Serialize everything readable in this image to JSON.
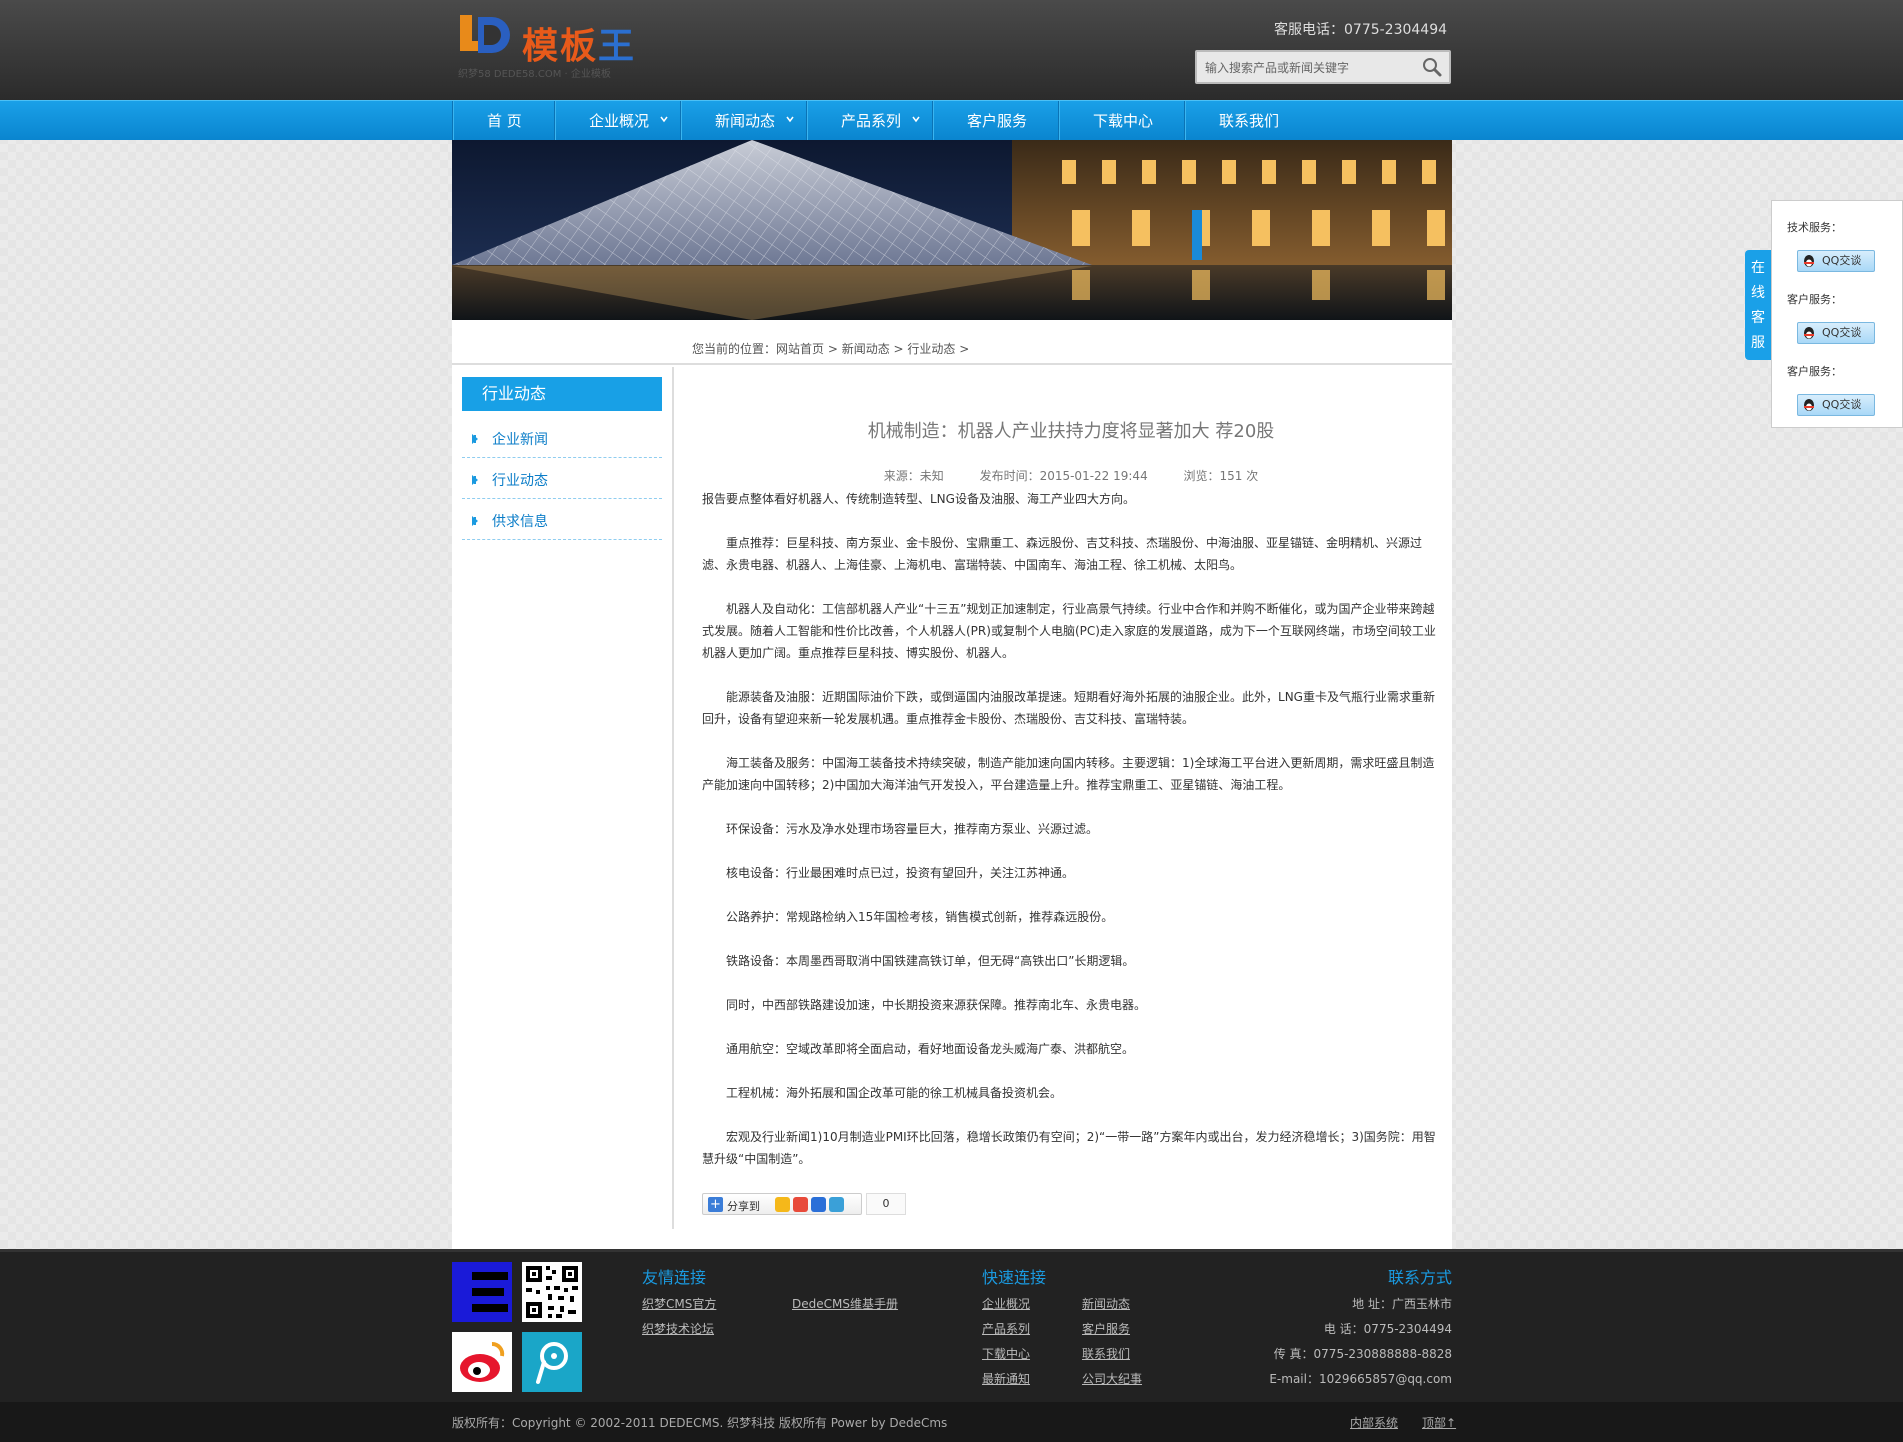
{
  "header": {
    "logo_text_a": "模板",
    "logo_text_b": "王",
    "logo_sub": "织梦58 DEDE58.COM · 企业模板",
    "phone": "客服电话：0775-2304494",
    "search_placeholder": "输入搜索产品或新闻关键字"
  },
  "nav": {
    "items": [
      {
        "label": "首 页"
      },
      {
        "label": "企业概况"
      },
      {
        "label": "新闻动态"
      },
      {
        "label": "产品系列"
      },
      {
        "label": "客户服务"
      },
      {
        "label": "下载中心"
      },
      {
        "label": "联系我们"
      }
    ]
  },
  "breadcrumb": {
    "prefix": "您当前的位置：",
    "home": "网站首页",
    "sep1": " > ",
    "news": "新闻动态",
    "sep2": " > ",
    "current": "行业动态",
    "sep3": " >"
  },
  "sidebar": {
    "title": "行业动态",
    "items": [
      {
        "label": "企业新闻"
      },
      {
        "label": "行业动态"
      },
      {
        "label": "供求信息"
      }
    ]
  },
  "article": {
    "title": "机械制造：机器人产业扶持力度将显著加大 荐20股",
    "source": "来源：未知",
    "time": "发布时间：2015-01-22 19:44",
    "views": "浏览：151 次",
    "paragraphs": [
      "报告要点整体看好机器人、传统制造转型、LNG设备及油服、海工产业四大方向。",
      "重点推荐：巨星科技、南方泵业、金卡股份、宝鼎重工、森远股份、吉艾科技、杰瑞股份、中海油服、亚星锚链、金明精机、兴源过滤、永贵电器、机器人、上海佳豪、上海机电、富瑞特装、中国南车、海油工程、徐工机械、太阳鸟。",
      "机器人及自动化：工信部机器人产业“十三五”规划正加速制定，行业高景气持续。行业中合作和并购不断催化，或为国产企业带来跨越式发展。随着人工智能和性价比改善，个人机器人(PR)或复制个人电脑(PC)走入家庭的发展道路，成为下一个互联网终端，市场空间较工业机器人更加广阔。重点推荐巨星科技、博实股份、机器人。",
      "能源装备及油服：近期国际油价下跌，或倒逼国内油服改革提速。短期看好海外拓展的油服企业。此外，LNG重卡及气瓶行业需求重新回升，设备有望迎来新一轮发展机遇。重点推荐金卡股份、杰瑞股份、吉艾科技、富瑞特装。",
      "海工装备及服务：中国海工装备技术持续突破，制造产能加速向国内转移。主要逻辑：1)全球海工平台进入更新周期，需求旺盛且制造产能加速向中国转移；2)中国加大海洋油气开发投入，平台建造量上升。推荐宝鼎重工、亚星锚链、海油工程。",
      "环保设备：污水及净水处理市场容量巨大，推荐南方泵业、兴源过滤。",
      "核电设备：行业最困难时点已过，投资有望回升，关注江苏神通。",
      "公路养护：常规路检纳入15年国检考核，销售模式创新，推荐森远股份。",
      "铁路设备：本周墨西哥取消中国铁建高铁订单，但无碍“高铁出口”长期逻辑。",
      "同时，中西部铁路建设加速，中长期投资来源获保障。推荐南北车、永贵电器。",
      "通用航空：空域改革即将全面启动，看好地面设备龙头威海广泰、洪都航空。",
      "工程机械：海外拓展和国企改革可能的徐工机械具备投资机会。",
      "宏观及行业新闻1)10月制造业PMI环比回落，稳增长政策仍有空间；2)“一带一路”方案年内或出台，发力经济稳增长；3)国务院：用智慧升级“中国制造”。"
    ]
  },
  "share": {
    "label": "分享到",
    "count": "0"
  },
  "qq": {
    "tab": [
      "在",
      "线",
      "客",
      "服"
    ],
    "groups": [
      {
        "label": "技术服务：",
        "button": "QQ交谈"
      },
      {
        "label": "客户服务：",
        "button": "QQ交谈"
      },
      {
        "label": "客户服务：",
        "button": "QQ交谈"
      }
    ]
  },
  "footer": {
    "friends_title": "友情连接",
    "friends": [
      "织梦CMS官方",
      "DedeCMS维基手册",
      "织梦技术论坛"
    ],
    "quick_title": "快速连接",
    "quick": [
      "企业概况",
      "新闻动态",
      "产品系列",
      "客户服务",
      "下载中心",
      "联系我们",
      "最新通知",
      "公司大纪事"
    ],
    "contact_title": "联系方式",
    "contact": [
      "地 址：广西玉林市",
      "电 话：0775-2304494",
      "传 真：0775-230888888-8828",
      "E-mail：1029665857@qq.com"
    ],
    "copyright": "版权所有：Copyright © 2002-2011 DEDECMS. 织梦科技 版权所有 Power by DedeCms",
    "internal": "内部系统",
    "top": "顶部↑"
  },
  "colors": {
    "accent": "#1aa0e8",
    "header_bg": "#333333",
    "footer_bg": "#222222"
  }
}
